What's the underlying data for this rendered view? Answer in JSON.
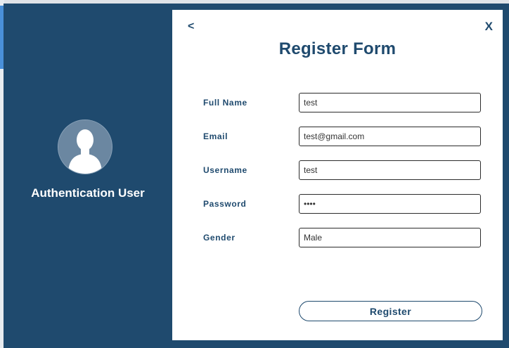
{
  "sidebar": {
    "avatar_icon": "user-silhouette-icon",
    "title": "Authentication User"
  },
  "form": {
    "back_label": "<",
    "close_label": "X",
    "title": "Register Form",
    "fields": [
      {
        "label": "Full Name",
        "value": "test",
        "type": "text"
      },
      {
        "label": "Email",
        "value": "test@gmail.com",
        "type": "text"
      },
      {
        "label": "Username",
        "value": "test",
        "type": "text"
      },
      {
        "label": "Password",
        "value": "test",
        "type": "password"
      },
      {
        "label": "Gender",
        "value": "Male",
        "type": "text"
      }
    ],
    "submit_label": "Register"
  },
  "colors": {
    "primary": "#1f4a6e",
    "panel": "#ffffff",
    "avatar_bg": "#6b87a1"
  }
}
